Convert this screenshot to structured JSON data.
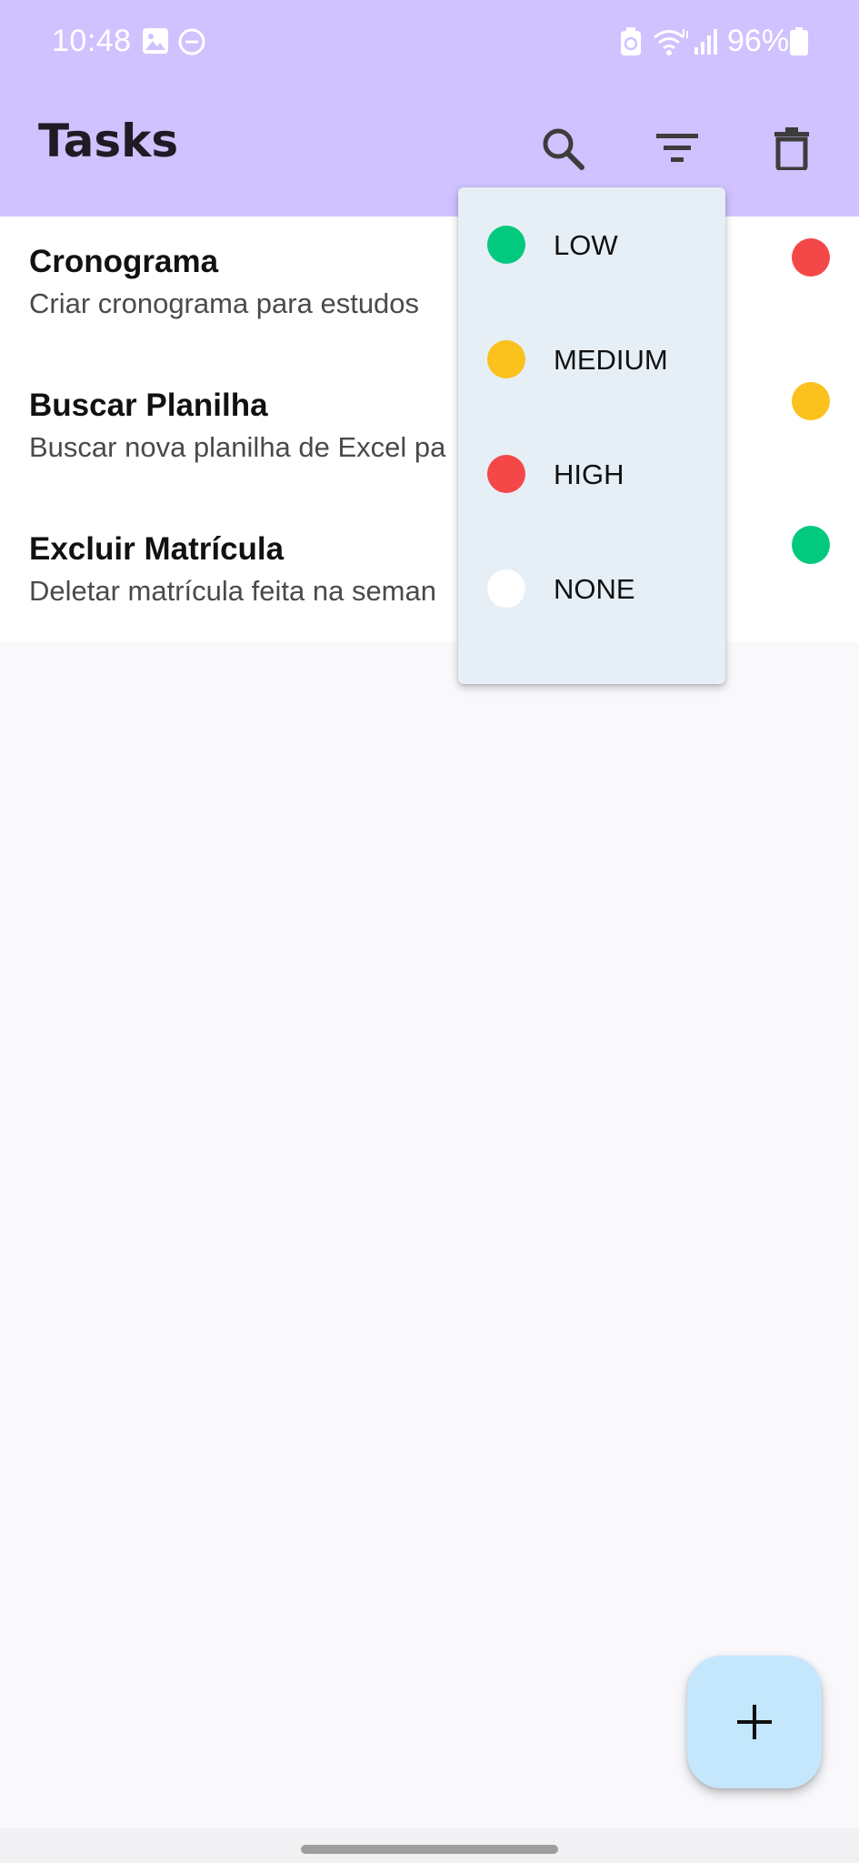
{
  "status_bar": {
    "time": "10:48",
    "battery": "96%",
    "icons": [
      "image-icon",
      "do-not-disturb-icon",
      "battery-saver-icon",
      "wifi-icon",
      "signal-icon",
      "battery-icon"
    ]
  },
  "app_bar": {
    "title": "Tasks",
    "actions": [
      "search-icon",
      "filter-icon",
      "delete-icon"
    ]
  },
  "tasks": [
    {
      "title": "Cronograma",
      "description": "Criar cronograma para estudos",
      "priority": "HIGH",
      "color": "#f44848"
    },
    {
      "title": "Buscar Planilha",
      "description": "Buscar nova planilha de Excel pa",
      "priority": "MEDIUM",
      "color": "#fbc11c"
    },
    {
      "title": "Excluir Matrícula",
      "description": "Deletar matrícula feita na seman",
      "priority": "LOW",
      "color": "#02c97e"
    }
  ],
  "priority_menu": {
    "items": [
      {
        "label": "LOW",
        "color": "#02c97e"
      },
      {
        "label": "MEDIUM",
        "color": "#fbc11c"
      },
      {
        "label": "HIGH",
        "color": "#f44848"
      },
      {
        "label": "NONE",
        "color": "#ffffff"
      }
    ]
  },
  "fab": {
    "icon": "plus-icon"
  },
  "colors": {
    "app_bar": "#d0c2ff",
    "fab": "#c4e7fe",
    "menu": "#e7eff6",
    "background": "#f9f9fc"
  }
}
